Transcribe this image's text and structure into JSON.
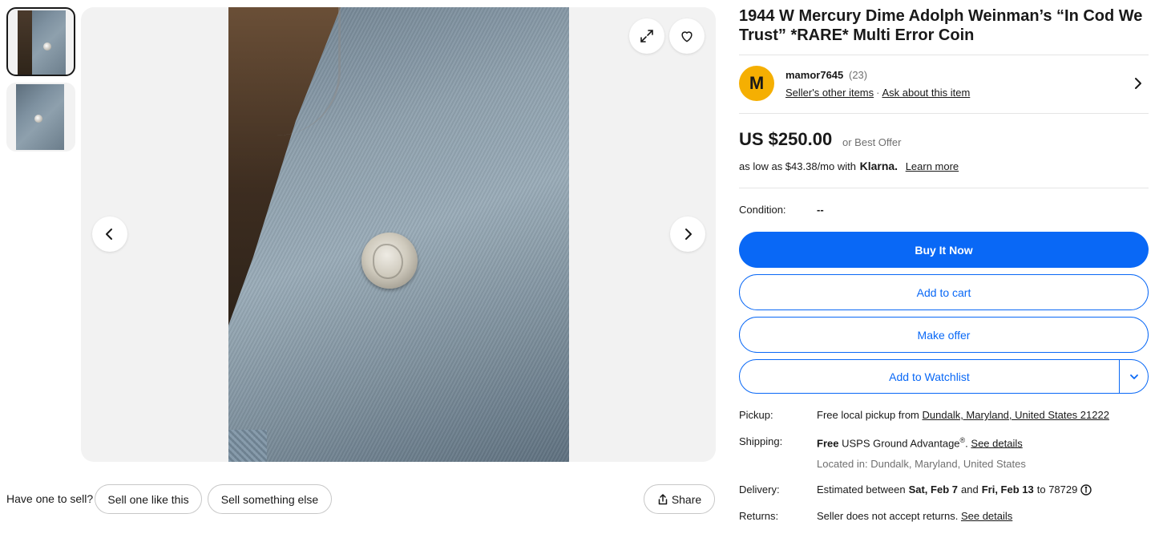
{
  "thumbnails": [
    {
      "alt": "thumbnail-1",
      "selected": true
    },
    {
      "alt": "thumbnail-2",
      "selected": false
    }
  ],
  "sell_row": {
    "label": "Have one to sell?",
    "sell_one": "Sell one like this",
    "sell_else": "Sell something else",
    "share": "Share"
  },
  "listing": {
    "title": "1944 W Mercury Dime Adolph Weinman’s “In Cod We Trust” *RARE* Multi Error Coin"
  },
  "seller": {
    "initial": "M",
    "name": "mamor7645",
    "count": "(23)",
    "other_items": "Seller's other items",
    "ask": "Ask about this item"
  },
  "price": {
    "amount": "US $250.00",
    "best_offer": "or Best Offer",
    "installment_prefix": "as low as $43.38/mo with",
    "klarna": "Klarna.",
    "learn_more": "Learn more"
  },
  "condition": {
    "label": "Condition:",
    "value": "--"
  },
  "actions": {
    "buy_now": "Buy It Now",
    "add_to_cart": "Add to cart",
    "make_offer": "Make offer",
    "watchlist": "Add to Watchlist"
  },
  "details": {
    "pickup_label": "Pickup:",
    "pickup_prefix": "Free local pickup from",
    "pickup_location": "Dundalk, Maryland, United States 21222",
    "shipping_label": "Shipping:",
    "shipping_free": "Free",
    "shipping_service": "USPS Ground Advantage",
    "shipping_reg": "®",
    "shipping_see": "See details",
    "located_in": "Located in: Dundalk, Maryland, United States",
    "delivery_label": "Delivery:",
    "delivery_prefix": "Estimated between",
    "delivery_start": "Sat, Feb 7",
    "delivery_and": "and",
    "delivery_end": "Fri, Feb 13",
    "delivery_to": "to 78729",
    "returns_label": "Returns:",
    "returns_text": "Seller does not accept returns.",
    "returns_see": "See details"
  },
  "colors": {
    "accent": "#0968f6",
    "avatar": "#f5af02",
    "text": "#191919",
    "muted": "#707070"
  }
}
